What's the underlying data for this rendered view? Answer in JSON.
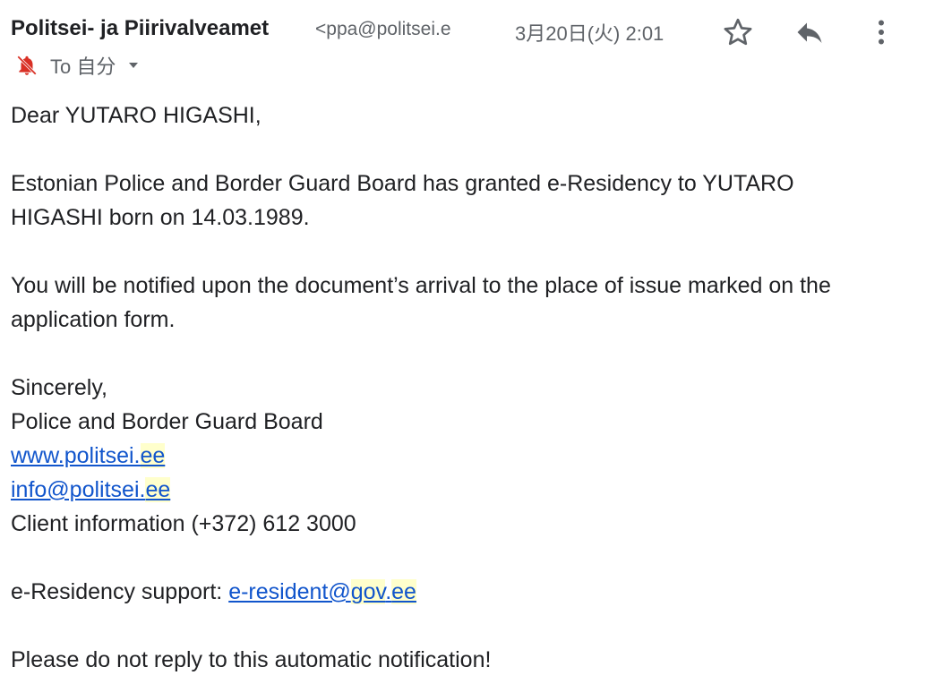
{
  "header": {
    "sender_name": "Politsei- ja Piirivalveamet",
    "sender_email": "<ppa@politsei.e",
    "date": "3月20日(火) 2:01",
    "icons": {
      "star": "star-icon",
      "reply": "reply-icon",
      "more": "more-vert-icon"
    }
  },
  "recipient": {
    "label": "To 自分",
    "icons": {
      "mute": "muted-notification-icon",
      "caret": "chevron-down-icon"
    },
    "mute_color": "#d93025"
  },
  "body": {
    "greeting": "Dear YUTARO HIGASHI,",
    "para1_line1": "Estonian Police and Border Guard Board has granted e-Residency to YUTARO",
    "para1_line2": "HIGASHI born on 14.03.1989.",
    "para2_line1": "You will be notified upon the document’s arrival to the place of issue marked on the",
    "para2_line2": "application form.",
    "signoff": "Sincerely,",
    "org": "Police and Border Guard Board",
    "website_part1": "www.politsei.",
    "website_part2": "ee",
    "email_part1": "info@politsei.",
    "email_part2": "ee",
    "client_info": "Client information (+372) 612 3000",
    "support_label": "e-Residency support: ",
    "support_email_part1": "e-resident@",
    "support_email_part2": "gov",
    "support_email_part3": ".",
    "support_email_part4": "ee",
    "footer": "Please do not reply to this automatic notification!"
  },
  "colors": {
    "link": "#1155cc",
    "highlight": "#ffffcc",
    "muted_text": "#5f6368",
    "text": "#202124"
  }
}
